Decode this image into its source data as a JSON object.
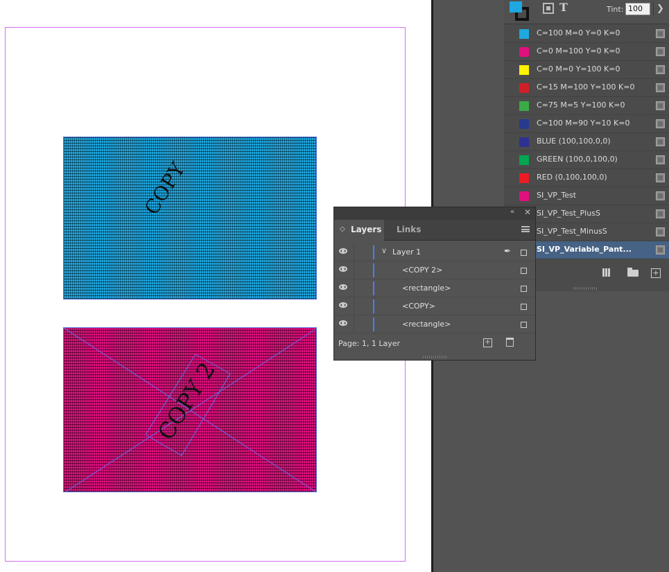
{
  "canvas": {
    "frame1_text": "COPY",
    "frame2_text": "COPY 2"
  },
  "swatches": {
    "tint_label": "Tint:",
    "tint_value": "100",
    "text_icon": "T",
    "items": [
      {
        "name": "C=100 M=0 Y=0 K=0",
        "color": "#1fa7e0"
      },
      {
        "name": "C=0 M=100 Y=0 K=0",
        "color": "#e0107f"
      },
      {
        "name": "C=0 M=0 Y=100 K=0",
        "color": "#fff200"
      },
      {
        "name": "C=15 M=100 Y=100 K=0",
        "color": "#d02027"
      },
      {
        "name": "C=75 M=5 Y=100 K=0",
        "color": "#3aaa46"
      },
      {
        "name": "C=100 M=90 Y=10 K=0",
        "color": "#273a8e"
      },
      {
        "name": "BLUE (100,100,0,0)",
        "color": "#2e3192"
      },
      {
        "name": "GREEN (100,0,100,0)",
        "color": "#00a651"
      },
      {
        "name": "RED (0,100,100,0)",
        "color": "#ed1c24"
      },
      {
        "name": "SI_VP_Test",
        "color": "#e0107f"
      },
      {
        "name": "SI_VP_Test_PlusS",
        "color": null
      },
      {
        "name": "SI_VP_Test_MinusS",
        "color": null
      },
      {
        "name": "SI_VP_Variable_Pant...",
        "color": null,
        "selected": true
      }
    ]
  },
  "layers": {
    "tabs": [
      {
        "label": "Layers",
        "active": true
      },
      {
        "label": "Links",
        "active": false
      }
    ],
    "rows": [
      {
        "name": "Layer 1",
        "level": 0,
        "expanded": true
      },
      {
        "name": "<COPY 2>",
        "level": 1
      },
      {
        "name": "<rectangle>",
        "level": 1
      },
      {
        "name": "<COPY>",
        "level": 1
      },
      {
        "name": "<rectangle>",
        "level": 1
      }
    ],
    "page_info": "Page: 1, 1 Layer",
    "layer_color": "#4d7cff"
  },
  "icons": {
    "visibility": "eye-icon",
    "expand": "chevron-down-icon",
    "pen": "pen-icon",
    "new": "new-item-icon",
    "delete": "trash-icon",
    "folder": "folder-icon",
    "menu": "panel-menu-icon"
  }
}
